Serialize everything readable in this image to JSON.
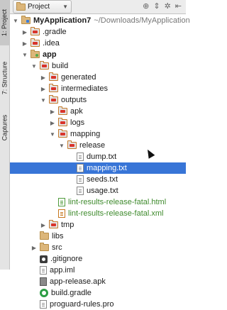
{
  "side_tabs": {
    "project": "1: Project",
    "structure": "7: Structure",
    "captures": "Captures"
  },
  "header": {
    "title": "Project"
  },
  "tree": [
    {
      "label": "MyApplication7",
      "hint": "~/Downloads/MyApplication",
      "bold": true,
      "arrow": "open",
      "icon": "folder-module",
      "indent": 0
    },
    {
      "label": ".gradle",
      "arrow": "closed",
      "icon": "folder-red",
      "indent": 1
    },
    {
      "label": ".idea",
      "arrow": "closed",
      "icon": "folder-red",
      "indent": 1
    },
    {
      "label": "app",
      "bold": true,
      "arrow": "open",
      "icon": "folder-module-green",
      "indent": 1
    },
    {
      "label": "build",
      "arrow": "open",
      "icon": "folder-red",
      "indent": 2
    },
    {
      "label": "generated",
      "arrow": "closed",
      "icon": "folder-red",
      "indent": 3
    },
    {
      "label": "intermediates",
      "arrow": "closed",
      "icon": "folder-red",
      "indent": 3
    },
    {
      "label": "outputs",
      "arrow": "open",
      "icon": "folder-red",
      "indent": 3
    },
    {
      "label": "apk",
      "arrow": "closed",
      "icon": "folder-red",
      "indent": 4
    },
    {
      "label": "logs",
      "arrow": "closed",
      "icon": "folder-red",
      "indent": 4
    },
    {
      "label": "mapping",
      "arrow": "open",
      "icon": "folder-red",
      "indent": 4
    },
    {
      "label": "release",
      "arrow": "open",
      "icon": "folder-red",
      "indent": 5
    },
    {
      "label": "dump.txt",
      "arrow": "none",
      "icon": "file",
      "indent": 6
    },
    {
      "label": "mapping.txt",
      "arrow": "none",
      "icon": "file",
      "indent": 6,
      "selected": true
    },
    {
      "label": "seeds.txt",
      "arrow": "none",
      "icon": "file",
      "indent": 6
    },
    {
      "label": "usage.txt",
      "arrow": "none",
      "icon": "file",
      "indent": 6
    },
    {
      "label": "lint-results-release-fatal.html",
      "arrow": "none",
      "icon": "file-green",
      "indent": 4,
      "color": "green"
    },
    {
      "label": "lint-results-release-fatal.xml",
      "arrow": "none",
      "icon": "file-orange",
      "indent": 4,
      "color": "green"
    },
    {
      "label": "tmp",
      "arrow": "closed",
      "icon": "folder-red",
      "indent": 3
    },
    {
      "label": "libs",
      "arrow": "none",
      "icon": "folder",
      "indent": 2
    },
    {
      "label": "src",
      "arrow": "closed",
      "icon": "folder",
      "indent": 2
    },
    {
      "label": ".gitignore",
      "arrow": "none",
      "icon": "dot",
      "indent": 2
    },
    {
      "label": "app.iml",
      "arrow": "none",
      "icon": "file",
      "indent": 2
    },
    {
      "label": "app-release.apk",
      "arrow": "none",
      "icon": "file-apk",
      "indent": 2
    },
    {
      "label": "build.gradle",
      "arrow": "none",
      "icon": "gradle",
      "indent": 2
    },
    {
      "label": "proguard-rules.pro",
      "arrow": "none",
      "icon": "file",
      "indent": 2
    }
  ]
}
